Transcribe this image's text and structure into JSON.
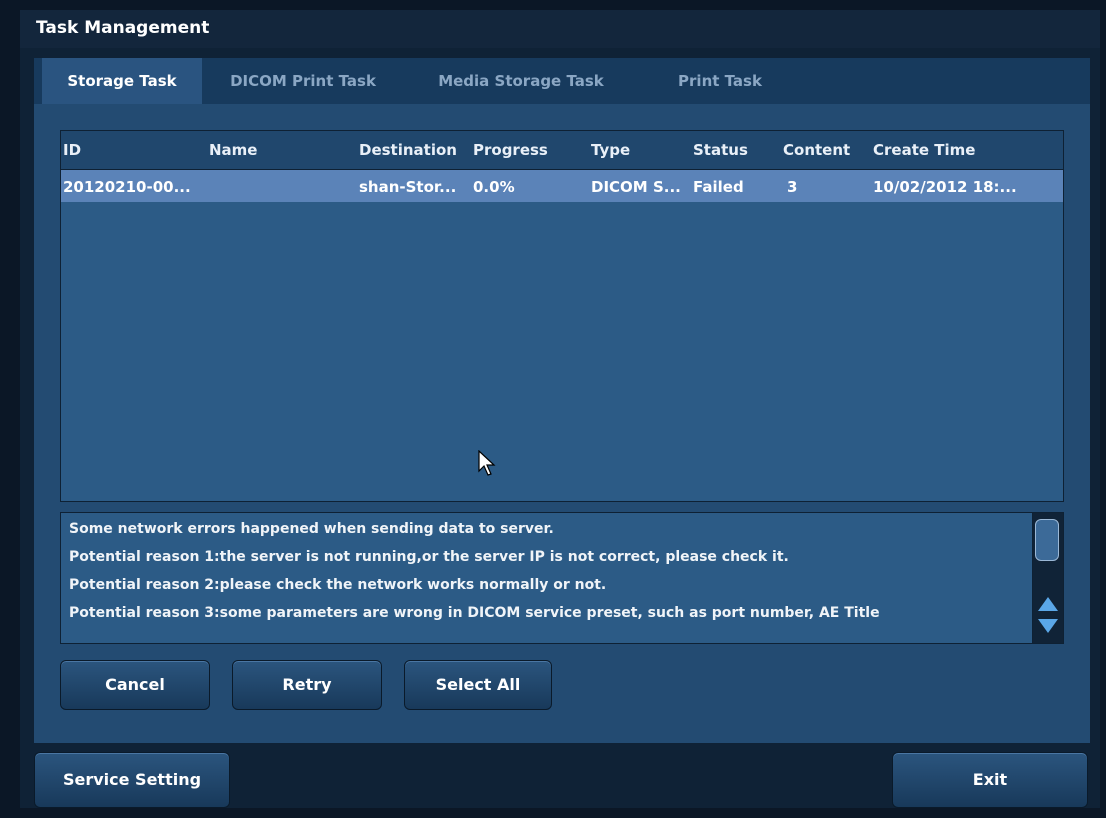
{
  "window": {
    "title": "Task Management"
  },
  "tabs": [
    {
      "label": "Storage Task",
      "active": true
    },
    {
      "label": "DICOM Print Task",
      "active": false
    },
    {
      "label": "Media Storage Task",
      "active": false
    },
    {
      "label": "Print Task",
      "active": false
    }
  ],
  "table": {
    "columns": [
      "ID",
      "Name",
      "Destination",
      "Progress",
      "Type",
      "Status",
      "Content",
      "Create Time"
    ],
    "rows": [
      {
        "id": "20120210-00...",
        "name": "",
        "destination": "shan-Stor...",
        "progress": "0.0%",
        "type": "DICOM S...",
        "status": "Failed",
        "content": "3",
        "create_time": "10/02/2012 18:..."
      }
    ]
  },
  "message": {
    "lines": [
      "Some network errors happened when sending data to server.",
      "Potential reason 1:the server is not running,or the server IP is not correct, please check it.",
      "Potential reason 2:please check the network works normally or not.",
      "Potential reason 3:some parameters are wrong in DICOM service preset, such as port number, AE Title"
    ]
  },
  "buttons": {
    "cancel": "Cancel",
    "retry": "Retry",
    "select_all": "Select All",
    "service_setting": "Service Setting",
    "exit": "Exit"
  },
  "colors": {
    "selected_row": "#5b83b8",
    "active_tab": "#2a5480",
    "scroll_arrow": "#5aa7e8"
  },
  "icons": {
    "scroll_up": "triangle-up-icon",
    "scroll_down": "triangle-down-icon",
    "cursor": "mouse-pointer-icon"
  }
}
